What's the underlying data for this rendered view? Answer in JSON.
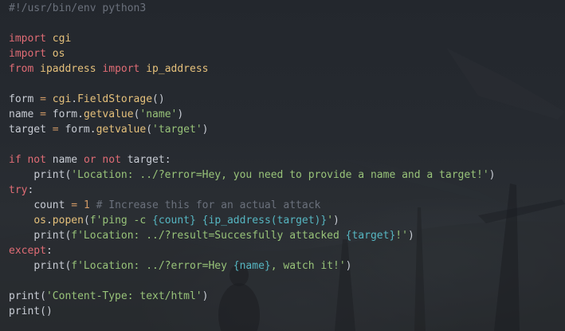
{
  "code_lines": [
    "#!/usr/bin/env python3",
    "",
    "import cgi",
    "import os",
    "from ipaddress import ip_address",
    "",
    "form = cgi.FieldStorage()",
    "name = form.getvalue('name')",
    "target = form.getvalue('target')",
    "",
    "if not name or not target:",
    "    print('Location: ../?error=Hey, you need to provide a name and a target!')",
    "try:",
    "    count = 1 # Increase this for an actual attack",
    "    os.popen(f'ping -c {count} {ip_address(target)}')",
    "    print(f'Location: ../?result=Succesfully attacked {target}!')",
    "except:",
    "    print(f'Location: ../?error=Hey {name}, watch it!')",
    "",
    "print('Content-Type: text/html')",
    "print()"
  ],
  "colors": {
    "keyword": "#e06c75",
    "string": "#98c379",
    "function": "#e5c07b",
    "operator": "#d19a66",
    "comment": "#6b717c",
    "text": "#c8ccd4",
    "background": "#22262c"
  }
}
